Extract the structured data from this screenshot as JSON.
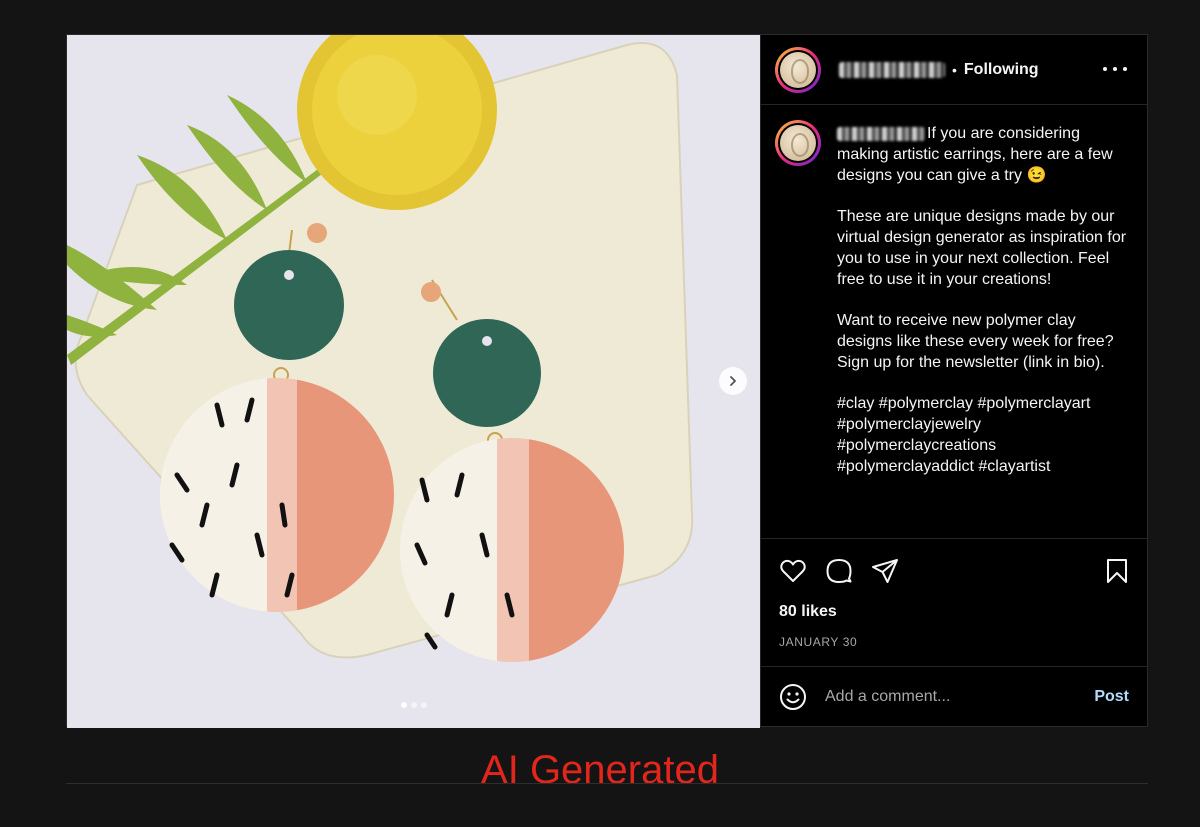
{
  "post": {
    "header": {
      "username_blurred": true,
      "separator": "•",
      "follow_status": "Following",
      "more_icon": "more-horizontal-icon"
    },
    "media": {
      "alt_subject": "polymer clay earrings",
      "carousel_dots": 3,
      "active_index": 0,
      "next_icon": "chevron-right-icon"
    },
    "caption": {
      "text": "If you are considering making artistic earrings, here are a few designs you can give a try 😉\n\nThese are unique designs made by our virtual design generator as inspiration for you to use in your next collection. Feel free to use it in your creations!\n\nWant to receive new polymer clay designs like these every week for free? Sign up for the newsletter (link in bio).\n\n#clay #polymerclay #polymerclayart #polymerclayjewelry #polymerclaycreations #polymerclayaddict #clayartist"
    },
    "actions": {
      "like_icon": "heart-icon",
      "comment_icon": "comment-bubble-icon",
      "share_icon": "paper-plane-icon",
      "save_icon": "bookmark-icon",
      "likes": "80 likes",
      "date": "JANUARY 30"
    },
    "comment": {
      "emoji_icon": "emoji-smile-icon",
      "placeholder": "Add a comment...",
      "post_label": "Post"
    }
  },
  "overlay_label": "AI Generated",
  "colors": {
    "page_bg": "#141414",
    "panel_bg": "#000000",
    "link_blue": "#b3dbff",
    "label_red": "#e2261c"
  }
}
